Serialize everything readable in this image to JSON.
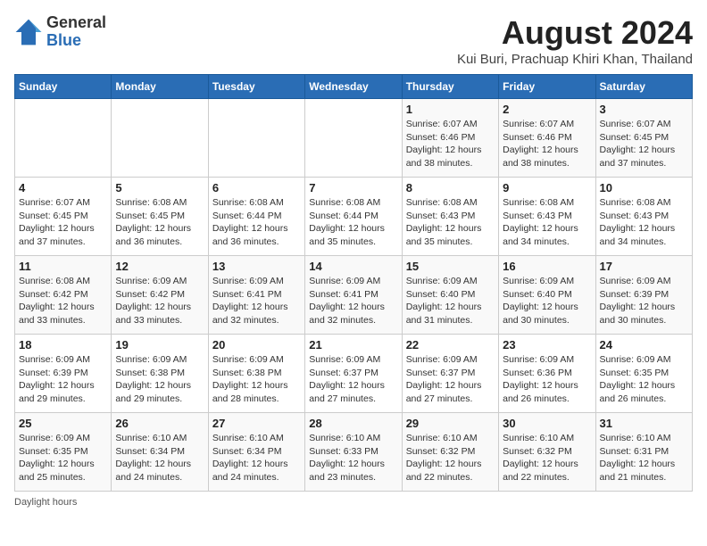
{
  "logo": {
    "general": "General",
    "blue": "Blue"
  },
  "title": "August 2024",
  "location": "Kui Buri, Prachuap Khiri Khan, Thailand",
  "days_of_week": [
    "Sunday",
    "Monday",
    "Tuesday",
    "Wednesday",
    "Thursday",
    "Friday",
    "Saturday"
  ],
  "weeks": [
    [
      {
        "day": "",
        "info": ""
      },
      {
        "day": "",
        "info": ""
      },
      {
        "day": "",
        "info": ""
      },
      {
        "day": "",
        "info": ""
      },
      {
        "day": "1",
        "info": "Sunrise: 6:07 AM\nSunset: 6:46 PM\nDaylight: 12 hours\nand 38 minutes."
      },
      {
        "day": "2",
        "info": "Sunrise: 6:07 AM\nSunset: 6:46 PM\nDaylight: 12 hours\nand 38 minutes."
      },
      {
        "day": "3",
        "info": "Sunrise: 6:07 AM\nSunset: 6:45 PM\nDaylight: 12 hours\nand 37 minutes."
      }
    ],
    [
      {
        "day": "4",
        "info": "Sunrise: 6:07 AM\nSunset: 6:45 PM\nDaylight: 12 hours\nand 37 minutes."
      },
      {
        "day": "5",
        "info": "Sunrise: 6:08 AM\nSunset: 6:45 PM\nDaylight: 12 hours\nand 36 minutes."
      },
      {
        "day": "6",
        "info": "Sunrise: 6:08 AM\nSunset: 6:44 PM\nDaylight: 12 hours\nand 36 minutes."
      },
      {
        "day": "7",
        "info": "Sunrise: 6:08 AM\nSunset: 6:44 PM\nDaylight: 12 hours\nand 35 minutes."
      },
      {
        "day": "8",
        "info": "Sunrise: 6:08 AM\nSunset: 6:43 PM\nDaylight: 12 hours\nand 35 minutes."
      },
      {
        "day": "9",
        "info": "Sunrise: 6:08 AM\nSunset: 6:43 PM\nDaylight: 12 hours\nand 34 minutes."
      },
      {
        "day": "10",
        "info": "Sunrise: 6:08 AM\nSunset: 6:43 PM\nDaylight: 12 hours\nand 34 minutes."
      }
    ],
    [
      {
        "day": "11",
        "info": "Sunrise: 6:08 AM\nSunset: 6:42 PM\nDaylight: 12 hours\nand 33 minutes."
      },
      {
        "day": "12",
        "info": "Sunrise: 6:09 AM\nSunset: 6:42 PM\nDaylight: 12 hours\nand 33 minutes."
      },
      {
        "day": "13",
        "info": "Sunrise: 6:09 AM\nSunset: 6:41 PM\nDaylight: 12 hours\nand 32 minutes."
      },
      {
        "day": "14",
        "info": "Sunrise: 6:09 AM\nSunset: 6:41 PM\nDaylight: 12 hours\nand 32 minutes."
      },
      {
        "day": "15",
        "info": "Sunrise: 6:09 AM\nSunset: 6:40 PM\nDaylight: 12 hours\nand 31 minutes."
      },
      {
        "day": "16",
        "info": "Sunrise: 6:09 AM\nSunset: 6:40 PM\nDaylight: 12 hours\nand 30 minutes."
      },
      {
        "day": "17",
        "info": "Sunrise: 6:09 AM\nSunset: 6:39 PM\nDaylight: 12 hours\nand 30 minutes."
      }
    ],
    [
      {
        "day": "18",
        "info": "Sunrise: 6:09 AM\nSunset: 6:39 PM\nDaylight: 12 hours\nand 29 minutes."
      },
      {
        "day": "19",
        "info": "Sunrise: 6:09 AM\nSunset: 6:38 PM\nDaylight: 12 hours\nand 29 minutes."
      },
      {
        "day": "20",
        "info": "Sunrise: 6:09 AM\nSunset: 6:38 PM\nDaylight: 12 hours\nand 28 minutes."
      },
      {
        "day": "21",
        "info": "Sunrise: 6:09 AM\nSunset: 6:37 PM\nDaylight: 12 hours\nand 27 minutes."
      },
      {
        "day": "22",
        "info": "Sunrise: 6:09 AM\nSunset: 6:37 PM\nDaylight: 12 hours\nand 27 minutes."
      },
      {
        "day": "23",
        "info": "Sunrise: 6:09 AM\nSunset: 6:36 PM\nDaylight: 12 hours\nand 26 minutes."
      },
      {
        "day": "24",
        "info": "Sunrise: 6:09 AM\nSunset: 6:35 PM\nDaylight: 12 hours\nand 26 minutes."
      }
    ],
    [
      {
        "day": "25",
        "info": "Sunrise: 6:09 AM\nSunset: 6:35 PM\nDaylight: 12 hours\nand 25 minutes."
      },
      {
        "day": "26",
        "info": "Sunrise: 6:10 AM\nSunset: 6:34 PM\nDaylight: 12 hours\nand 24 minutes."
      },
      {
        "day": "27",
        "info": "Sunrise: 6:10 AM\nSunset: 6:34 PM\nDaylight: 12 hours\nand 24 minutes."
      },
      {
        "day": "28",
        "info": "Sunrise: 6:10 AM\nSunset: 6:33 PM\nDaylight: 12 hours\nand 23 minutes."
      },
      {
        "day": "29",
        "info": "Sunrise: 6:10 AM\nSunset: 6:32 PM\nDaylight: 12 hours\nand 22 minutes."
      },
      {
        "day": "30",
        "info": "Sunrise: 6:10 AM\nSunset: 6:32 PM\nDaylight: 12 hours\nand 22 minutes."
      },
      {
        "day": "31",
        "info": "Sunrise: 6:10 AM\nSunset: 6:31 PM\nDaylight: 12 hours\nand 21 minutes."
      }
    ]
  ],
  "footer": "Daylight hours"
}
